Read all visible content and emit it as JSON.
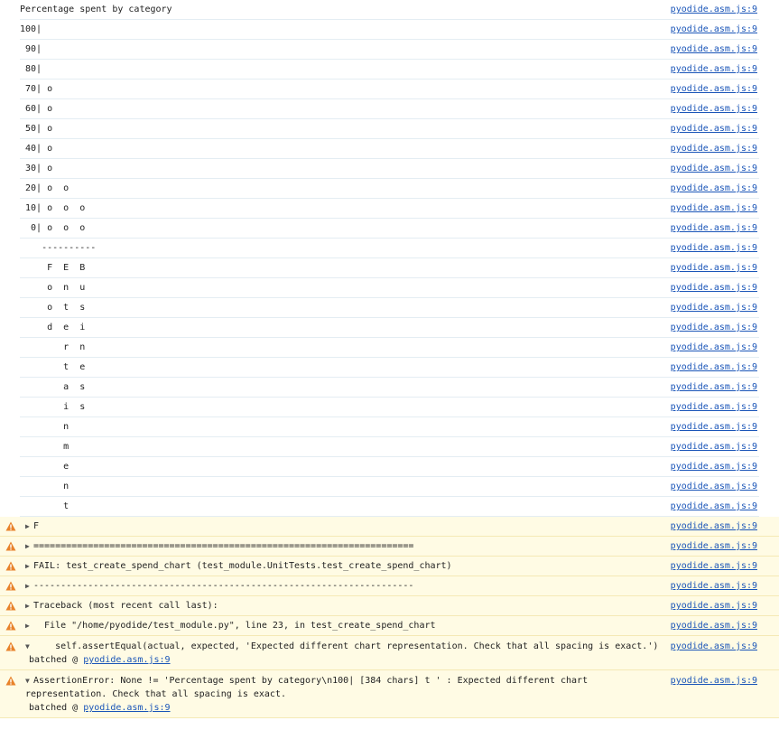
{
  "source_link": "pyodide.asm.js:9",
  "log_lines": [
    "Percentage spent by category",
    "100|",
    " 90|",
    " 80|",
    " 70| o",
    " 60| o",
    " 50| o",
    " 40| o",
    " 30| o",
    " 20| o  o",
    " 10| o  o  o",
    "  0| o  o  o",
    "    ----------",
    "     F  E  B",
    "     o  n  u",
    "     o  t  s",
    "     d  e  i",
    "        r  n",
    "        t  e",
    "        a  s",
    "        i  s",
    "        n",
    "        m",
    "        e",
    "        n",
    "        t"
  ],
  "warnings": [
    {
      "arrow": "▶",
      "text": "F"
    },
    {
      "arrow": "▶",
      "text": "======================================================================"
    },
    {
      "arrow": "▶",
      "text": "FAIL: test_create_spend_chart (test_module.UnitTests.test_create_spend_chart)"
    },
    {
      "arrow": "▶",
      "text": "----------------------------------------------------------------------"
    },
    {
      "arrow": "▶",
      "text": "Traceback (most recent call last):"
    },
    {
      "arrow": "▶",
      "text": "  File \"/home/pyodide/test_module.py\", line 23, in test_create_spend_chart"
    }
  ],
  "expanded_warnings": [
    {
      "arrow": "▼",
      "text": "    self.assertEqual(actual, expected, 'Expected different chart representation. Check that all spacing is exact.')",
      "batched_label": "batched @ ",
      "batched_link": "pyodide.asm.js:9"
    },
    {
      "arrow": "▼",
      "text": "AssertionError: None != 'Percentage spent by category\\n100|      [384 chars] t  ' : Expected different chart representation. Check that all spacing is exact.",
      "batched_label": "batched @ ",
      "batched_link": "pyodide.asm.js:9"
    }
  ],
  "colors": {
    "warning_bg": "#fffbe4",
    "link": "#1a55b8",
    "warning_icon": "#e8822a"
  },
  "icons": {
    "warning": "warning-triangle-icon"
  }
}
